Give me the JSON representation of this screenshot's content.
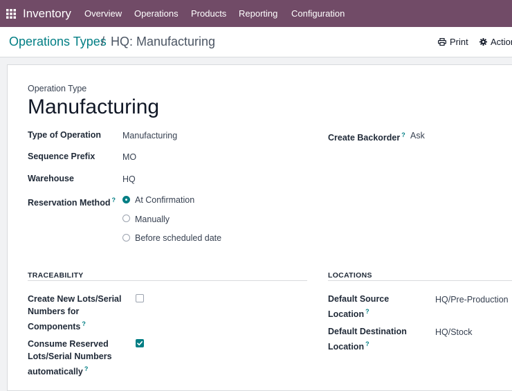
{
  "navbar": {
    "app_name": "Inventory",
    "menu": [
      "Overview",
      "Operations",
      "Products",
      "Reporting",
      "Configuration"
    ]
  },
  "breadcrumb": {
    "root": "Operations Types",
    "separator": "/",
    "current": "HQ: Manufacturing"
  },
  "actions": {
    "print": "Print",
    "action": "Action"
  },
  "form": {
    "overline": "Operation Type",
    "title": "Manufacturing",
    "fields": {
      "type_of_operation": {
        "label": "Type of Operation",
        "value": "Manufacturing"
      },
      "sequence_prefix": {
        "label": "Sequence Prefix",
        "value": "MO"
      },
      "warehouse": {
        "label": "Warehouse",
        "value": "HQ"
      },
      "reservation_method": {
        "label": "Reservation Method",
        "help": "?",
        "options": [
          "At Confirmation",
          "Manually",
          "Before scheduled date"
        ],
        "selected": "At Confirmation"
      },
      "create_backorder": {
        "label": "Create Backorder",
        "help": "?",
        "value": "Ask"
      }
    },
    "traceability": {
      "title": "TRACEABILITY",
      "create_lots": {
        "label_lines": [
          "Create New Lots/Serial",
          "Numbers for",
          "Components"
        ],
        "help": "?",
        "checked": false
      },
      "consume_reserved": {
        "label_lines": [
          "Consume Reserved",
          "Lots/Serial Numbers",
          "automatically"
        ],
        "help": "?",
        "checked": true
      }
    },
    "locations": {
      "title": "LOCATIONS",
      "default_source": {
        "label_lines": [
          "Default Source",
          "Location"
        ],
        "help": "?",
        "value": "HQ/Pre-Production"
      },
      "default_destination": {
        "label_lines": [
          "Default Destination",
          "Location"
        ],
        "help": "?",
        "value": "HQ/Stock"
      }
    }
  },
  "colors": {
    "brand": "#714b67",
    "accent": "#017e84",
    "background": "#f1f2f4"
  }
}
